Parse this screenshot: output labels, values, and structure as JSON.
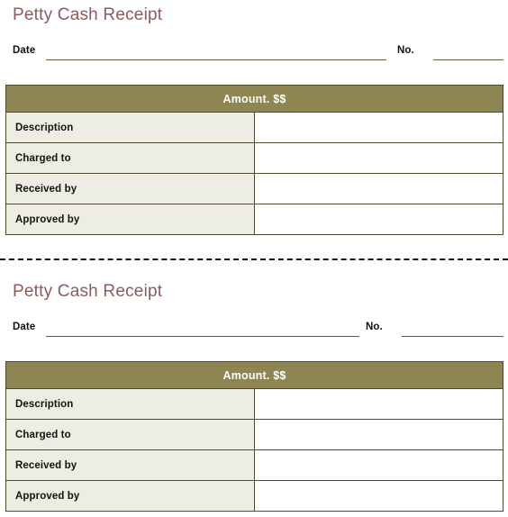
{
  "document": {
    "type": "petty-cash-receipt-form",
    "copies": 2
  },
  "colors": {
    "title": "#8c5b5b",
    "header_band": "#8d8552",
    "label_cell": "#eeede3",
    "border": "#4d4a31",
    "rule": "#5a5a3c",
    "cut_line": "#0d0d0d",
    "page_background": "#ffffff",
    "header_text": "#ffffff",
    "body_text": "#14120f"
  },
  "receipts": [
    {
      "title": "Petty Cash Receipt",
      "date_label": "Date",
      "date_value": "",
      "date_placeholder": "",
      "no_label": "No.",
      "no_value": "",
      "no_placeholder": "",
      "table": {
        "header": "Amount. $$",
        "rows": [
          {
            "label": "Description",
            "value": ""
          },
          {
            "label": "Charged to",
            "value": ""
          },
          {
            "label": "Received by",
            "value": ""
          },
          {
            "label": "Approved by",
            "value": ""
          }
        ]
      }
    },
    {
      "title": "Petty Cash Receipt",
      "date_label": "Date",
      "date_value": "",
      "date_placeholder": "",
      "no_label": "No.",
      "no_value": "",
      "no_placeholder": "",
      "table": {
        "header": "Amount. $$",
        "rows": [
          {
            "label": "Description",
            "value": ""
          },
          {
            "label": "Charged to",
            "value": ""
          },
          {
            "label": "Received by",
            "value": ""
          },
          {
            "label": "Approved by",
            "value": ""
          }
        ]
      }
    }
  ],
  "separator": {
    "name": "cut-here-dashed-line"
  }
}
